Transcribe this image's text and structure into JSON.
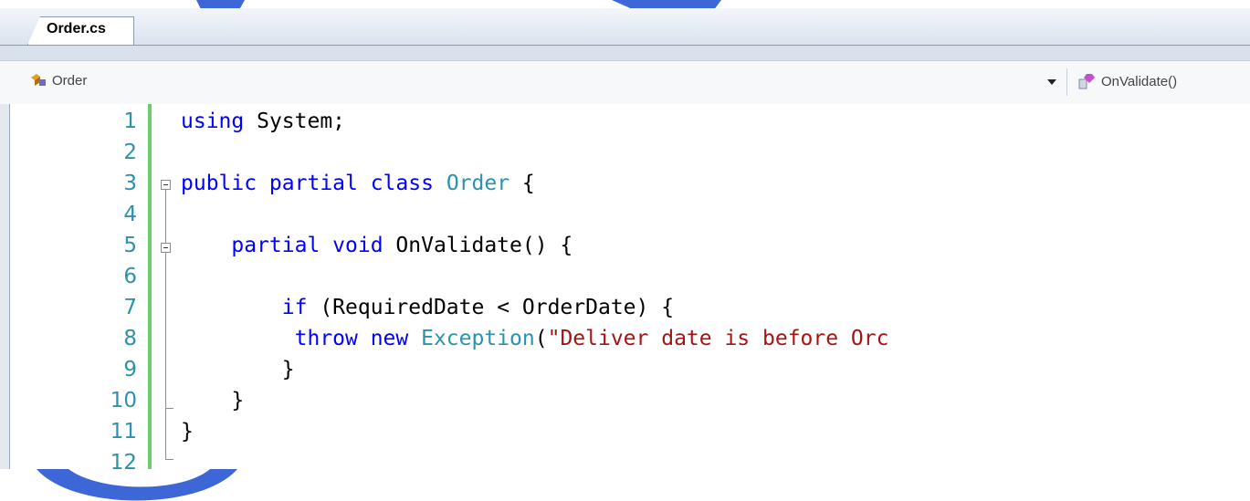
{
  "tab": {
    "label": "Order.cs"
  },
  "navbar": {
    "class_selector": "Order",
    "member_selector": "OnValidate()",
    "class_icon": "class-icon",
    "member_icon": "method-icon"
  },
  "code_lines": [
    {
      "num": "1",
      "tokens": [
        {
          "t": "using",
          "c": "kw"
        },
        {
          "t": " System;",
          "c": "plain"
        }
      ]
    },
    {
      "num": "2",
      "tokens": []
    },
    {
      "num": "3",
      "tokens": [
        {
          "t": "public partial class",
          "c": "kw"
        },
        {
          "t": " ",
          "c": "plain"
        },
        {
          "t": "Order",
          "c": "type"
        },
        {
          "t": " {",
          "c": "plain"
        }
      ]
    },
    {
      "num": "4",
      "tokens": []
    },
    {
      "num": "5",
      "tokens": [
        {
          "t": "    ",
          "c": "plain"
        },
        {
          "t": "partial void",
          "c": "kw"
        },
        {
          "t": " OnValidate() {",
          "c": "plain"
        }
      ]
    },
    {
      "num": "6",
      "tokens": []
    },
    {
      "num": "7",
      "tokens": [
        {
          "t": "        ",
          "c": "plain"
        },
        {
          "t": "if",
          "c": "kw"
        },
        {
          "t": " (RequiredDate < OrderDate) {",
          "c": "plain"
        }
      ]
    },
    {
      "num": "8",
      "tokens": [
        {
          "t": "         ",
          "c": "plain"
        },
        {
          "t": "throw new",
          "c": "kw"
        },
        {
          "t": " ",
          "c": "plain"
        },
        {
          "t": "Exception",
          "c": "type"
        },
        {
          "t": "(",
          "c": "plain"
        },
        {
          "t": "\"Deliver date is before Orc",
          "c": "str"
        }
      ]
    },
    {
      "num": "9",
      "tokens": [
        {
          "t": "        }",
          "c": "plain"
        }
      ]
    },
    {
      "num": "10",
      "tokens": [
        {
          "t": "    }",
          "c": "plain"
        }
      ]
    },
    {
      "num": "11",
      "tokens": [
        {
          "t": "}",
          "c": "plain"
        }
      ]
    },
    {
      "num": "12",
      "tokens": []
    }
  ],
  "colors": {
    "keyword": "#0000ff",
    "type": "#2b91af",
    "string": "#a31515",
    "line_number": "#2b91af",
    "change_bar": "#6ccc6c"
  }
}
